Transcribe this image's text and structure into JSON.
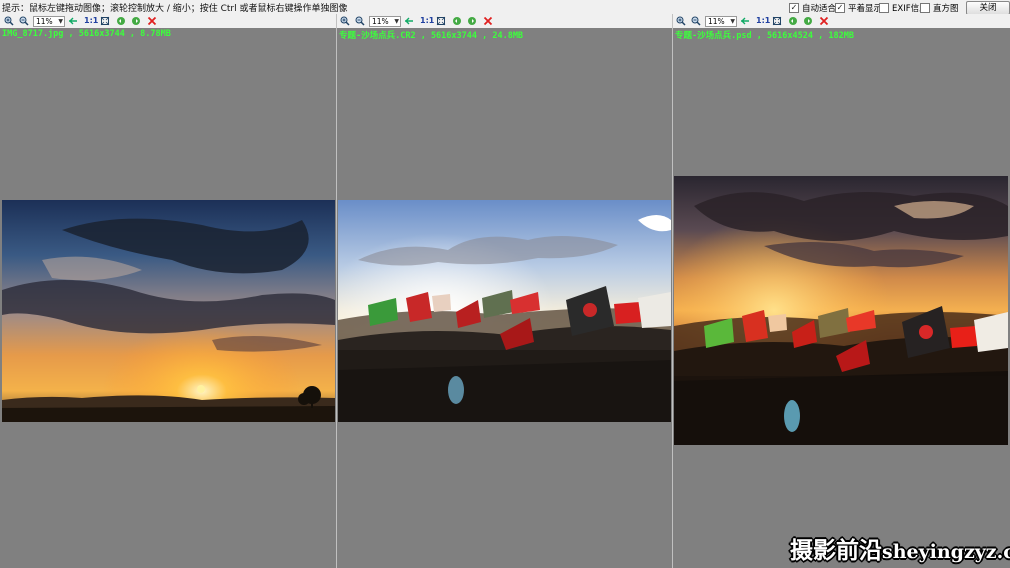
{
  "hint": "提示：鼠标左键拖动图像；滚轮控制放大 / 缩小；按住 Ctrl 或者鼠标右键操作单独图像",
  "options": [
    {
      "label": "自动适合",
      "checked": true
    },
    {
      "label": "平着显示",
      "checked": true
    },
    {
      "label": "EXIF信息",
      "checked": false
    },
    {
      "label": "直方图",
      "checked": false
    }
  ],
  "close_label": "关闭",
  "panes": [
    {
      "zoom": "11%",
      "one_to_one": "1:1",
      "info": "IMG_8717.jpg , 5616x3744 , 8.78MB"
    },
    {
      "zoom": "11%",
      "one_to_one": "1:1",
      "info": "专题-沙场点兵.CR2 , 5616x3744 , 24.8MB"
    },
    {
      "zoom": "11%",
      "one_to_one": "1:1",
      "info": "专题-沙场点兵.psd , 5616x4524 , 182MB"
    }
  ],
  "watermark": {
    "cn": "摄影前沿",
    "en": "sheyingzyz.com"
  },
  "colors": {
    "viewer_bg": "#808080",
    "info_text": "#3cff3c",
    "delete": "#e02020"
  }
}
